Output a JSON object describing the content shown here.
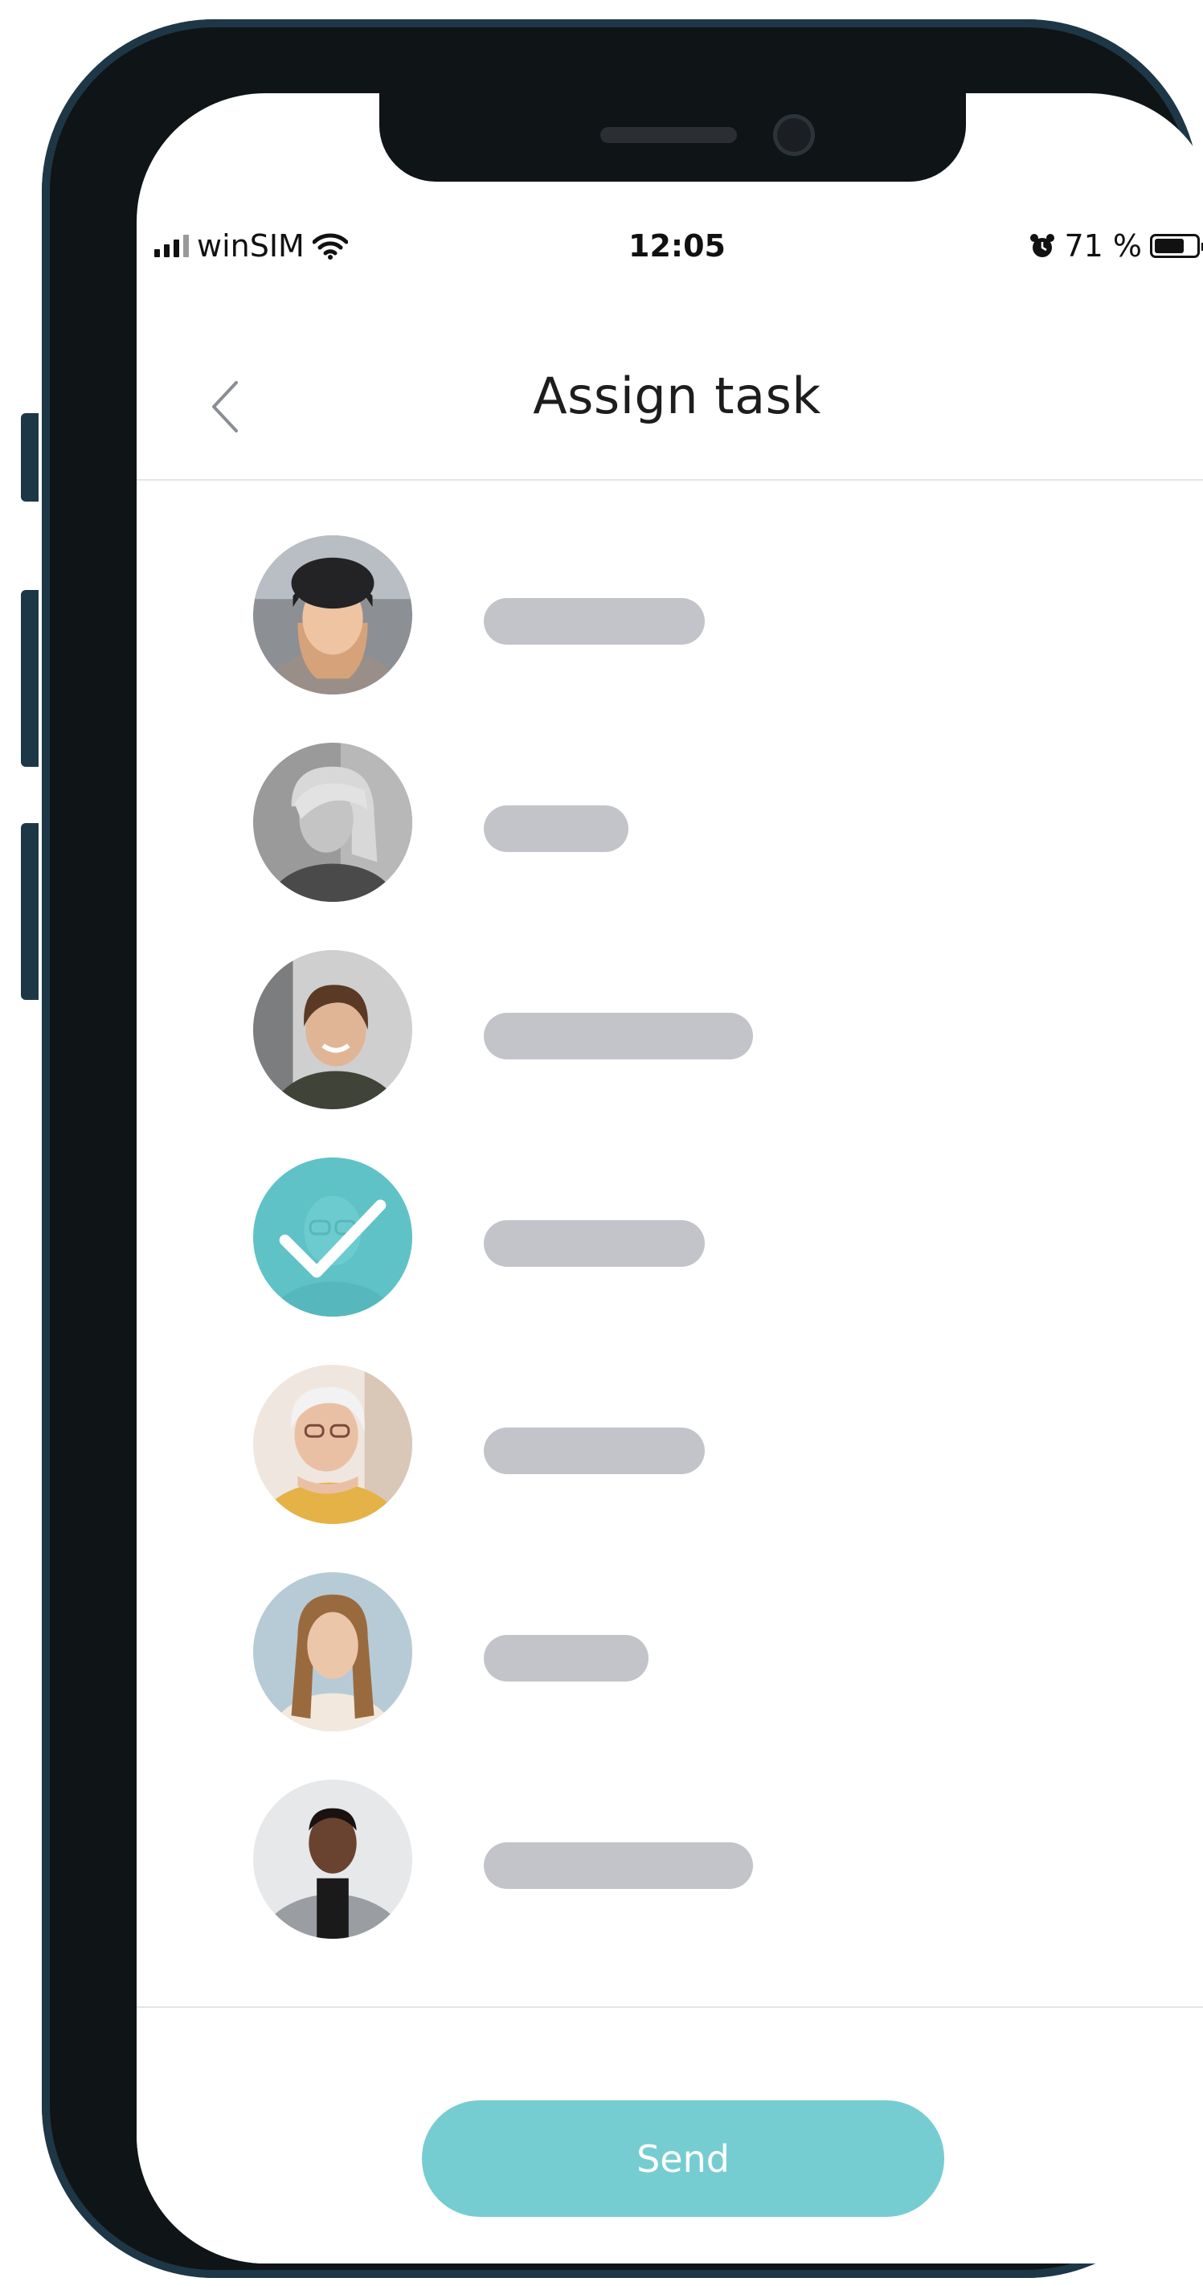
{
  "status_bar": {
    "carrier": "winSIM",
    "time": "12:05",
    "battery": "71 %",
    "battery_level": 0.71
  },
  "header": {
    "title": "Assign task",
    "back_icon": "chevron-left-icon"
  },
  "contacts": [
    {
      "avatar": "woman-beanie-avatar",
      "selected": false
    },
    {
      "avatar": "blonde-woman-grayscale-avatar",
      "selected": false
    },
    {
      "avatar": "smiling-woman-avatar",
      "selected": false
    },
    {
      "avatar": "man-glasses-avatar",
      "selected": true
    },
    {
      "avatar": "elderly-woman-avatar",
      "selected": false
    },
    {
      "avatar": "young-woman-avatar",
      "selected": false
    },
    {
      "avatar": "man-blazer-avatar",
      "selected": false
    }
  ],
  "footer": {
    "send_label": "Send"
  },
  "colors": {
    "accent": "#76cdd1",
    "selected_overlay": "#5fc2c6",
    "placeholder": "#c2c4c9",
    "frame": "#1e3747"
  }
}
